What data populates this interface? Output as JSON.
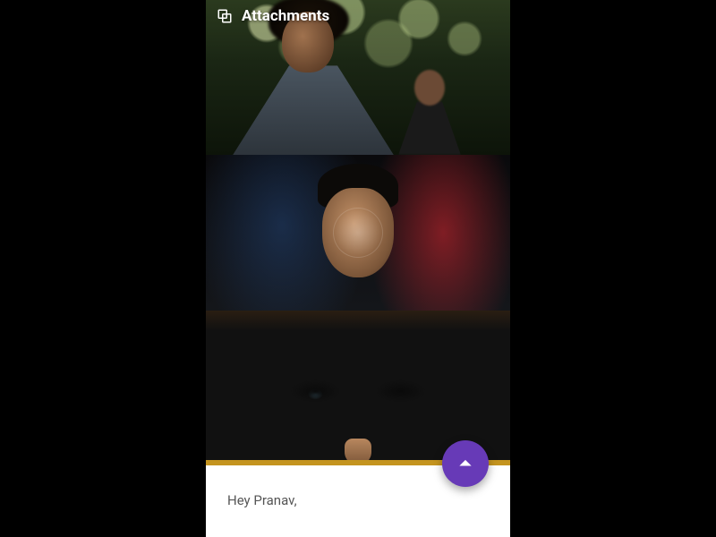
{
  "header": {
    "title": "Attachments"
  },
  "attachments": [
    {
      "alt": "Man looking up outdoors with green bokeh background, second person behind"
    },
    {
      "alt": "Portrait of a man with red and blue light flare"
    },
    {
      "alt": "Extreme close-up of a man's eyes and brow"
    }
  ],
  "compose": {
    "body_preview": "Hey Pranav,"
  },
  "fab": {
    "label": "Collapse"
  },
  "colors": {
    "accent": "#673AB7",
    "strip": "#c4941f"
  }
}
